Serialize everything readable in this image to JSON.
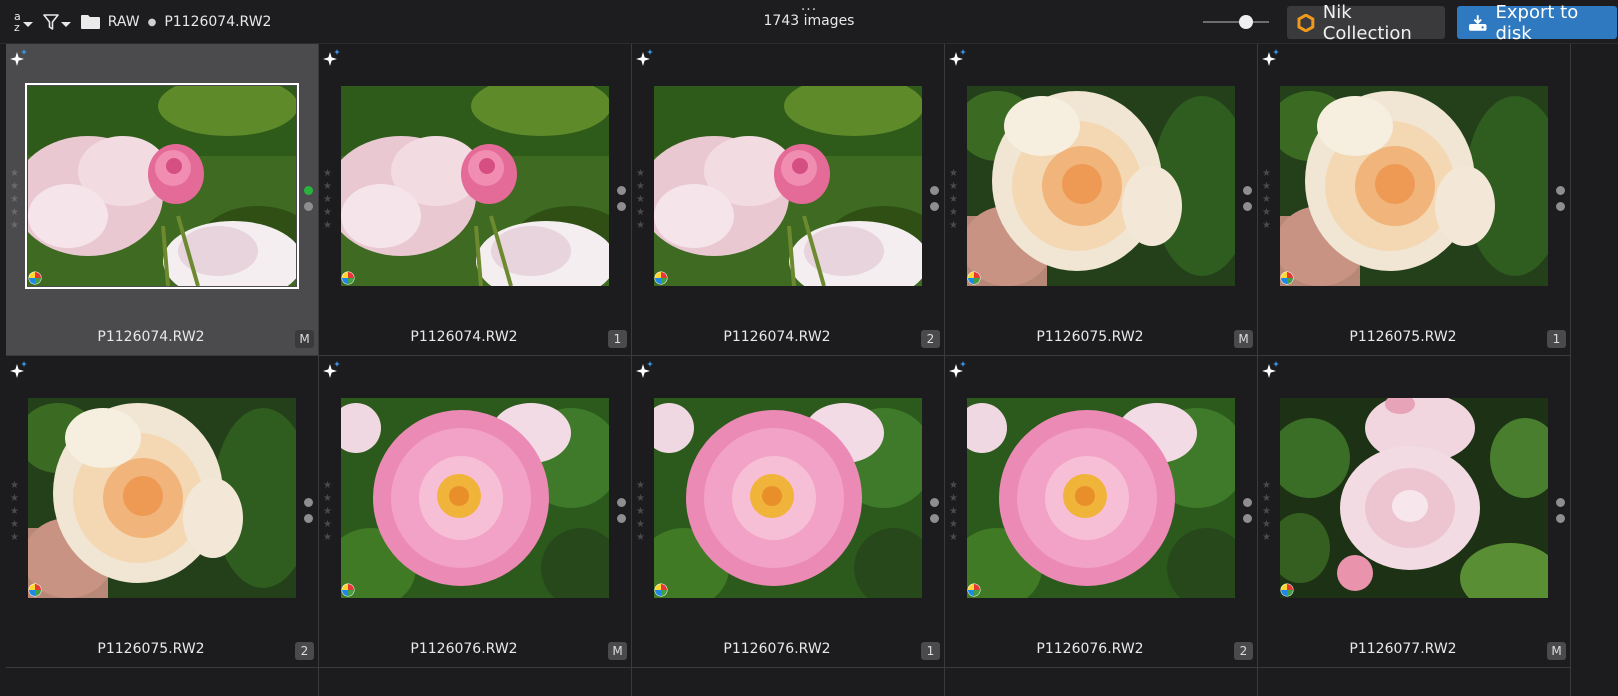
{
  "toolbar": {
    "sort_top": "a",
    "sort_bottom": "z",
    "folder": "RAW",
    "current_file": "P1126074.RW2",
    "more": "...",
    "image_count": "1743 images",
    "nik_label": "Nik Collection",
    "export_label": "Export to disk"
  },
  "colors": {
    "accent": "#2e79c0",
    "selected_cell": "#4b4b4d",
    "background": "#1c1c1e",
    "green_dot": "#29b33e"
  },
  "thumbnails": [
    {
      "filename": "P1126074.RW2",
      "badge": "M",
      "image": "pink-rose-bud",
      "selected": true,
      "dot_color": "green"
    },
    {
      "filename": "P1126074.RW2",
      "badge": "1",
      "image": "pink-rose-bud",
      "selected": false,
      "dot_color": "gray"
    },
    {
      "filename": "P1126074.RW2",
      "badge": "2",
      "image": "pink-rose-bud",
      "selected": false,
      "dot_color": "gray"
    },
    {
      "filename": "P1126075.RW2",
      "badge": "M",
      "image": "peach-rose",
      "selected": false,
      "dot_color": "gray"
    },
    {
      "filename": "P1126075.RW2",
      "badge": "1",
      "image": "peach-rose",
      "selected": false,
      "dot_color": "gray"
    },
    {
      "filename": "P1126075.RW2",
      "badge": "2",
      "image": "peach-rose",
      "selected": false,
      "dot_color": "gray"
    },
    {
      "filename": "P1126076.RW2",
      "badge": "M",
      "image": "pink-rose",
      "selected": false,
      "dot_color": "gray"
    },
    {
      "filename": "P1126076.RW2",
      "badge": "1",
      "image": "pink-rose",
      "selected": false,
      "dot_color": "gray"
    },
    {
      "filename": "P1126076.RW2",
      "badge": "2",
      "image": "pink-rose",
      "selected": false,
      "dot_color": "gray"
    },
    {
      "filename": "P1126077.RW2",
      "badge": "M",
      "image": "pale-rose-cluster",
      "selected": false,
      "dot_color": "gray"
    }
  ]
}
